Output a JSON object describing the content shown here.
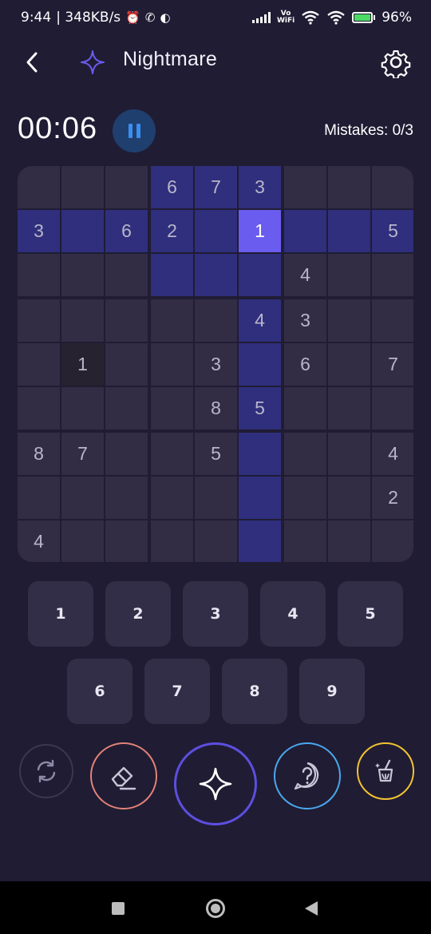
{
  "status_bar": {
    "time": "9:44",
    "network_speed": "| 348KB/s",
    "vowifi_top": "Vo",
    "vowifi_bottom": "WiFi",
    "battery": "96%"
  },
  "header": {
    "title": "Nightmare",
    "back_icon": "chevron-left-icon",
    "difficulty_icon": "sparkle-icon",
    "settings_icon": "gear-icon"
  },
  "game": {
    "timer": "00:06",
    "mistakes": "Mistakes: 0/3"
  },
  "board": {
    "rows": [
      [
        "",
        "",
        "",
        "6",
        "7",
        "3",
        "",
        "",
        ""
      ],
      [
        "3",
        "",
        "6",
        "2",
        "",
        "1",
        "",
        "",
        "5"
      ],
      [
        "",
        "",
        "",
        "",
        "",
        "",
        "4",
        "",
        ""
      ],
      [
        "",
        "",
        "",
        "",
        "",
        "4",
        "3",
        "",
        ""
      ],
      [
        "",
        "1",
        "",
        "",
        "3",
        "",
        "6",
        "",
        "7"
      ],
      [
        "",
        "",
        "",
        "",
        "8",
        "5",
        "",
        "",
        ""
      ],
      [
        "8",
        "7",
        "",
        "",
        "5",
        "",
        "",
        "",
        "4"
      ],
      [
        "",
        "",
        "",
        "",
        "",
        "",
        "",
        "",
        "2"
      ],
      [
        "4",
        "",
        "",
        "",
        "",
        "",
        "",
        "",
        ""
      ]
    ],
    "selected_cell": {
      "row": 1,
      "col": 5
    },
    "same_number_cells": [
      {
        "row": 4,
        "col": 1
      }
    ]
  },
  "number_pad": [
    "1",
    "2",
    "3",
    "4",
    "5",
    "6",
    "7",
    "8",
    "9"
  ],
  "tools": [
    {
      "name": "undo",
      "icon": "refresh-icon",
      "color": "#3b3752"
    },
    {
      "name": "erase",
      "icon": "eraser-icon",
      "color": "#e08378"
    },
    {
      "name": "magic",
      "icon": "sparkle-icon",
      "color": "#5b4fe0"
    },
    {
      "name": "hint",
      "icon": "question-bubble-icon",
      "color": "#49a8ee"
    },
    {
      "name": "auto",
      "icon": "broom-icon",
      "color": "#f2c233"
    }
  ],
  "colors": {
    "background": "#201c33",
    "cell": "#322d45",
    "highlight": "#2f2f7e",
    "selected": "#6b5cf0"
  }
}
